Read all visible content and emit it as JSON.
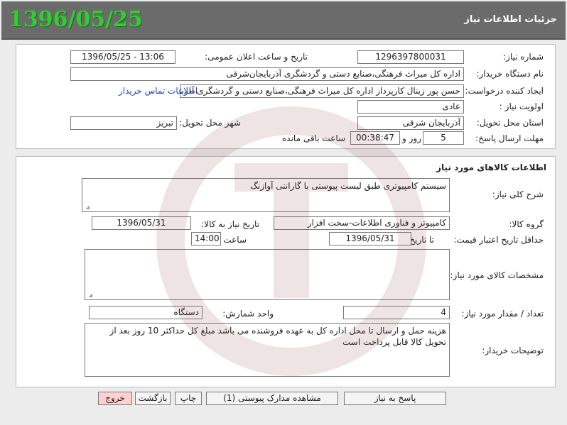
{
  "header": {
    "title": "جزئیات اطلاعات نیاز",
    "date": "1396/05/25"
  },
  "info": {
    "need_number_label": "شماره نیاز:",
    "need_number": "1296397800031",
    "announce_label": "تاریخ و ساعت اعلان عمومی:",
    "announce_value": "1396/05/25 - 13:06",
    "buyer_label": "نام دستگاه خریدار:",
    "buyer_value": "اداره کل میراث فرهنگی،صنایع دستی و گردشگری آذربایجان‌شرقی",
    "creator_label": "ایجاد کننده درخواست:",
    "creator_value": "حسن پور زینال کارپرداز اداره کل میراث فرهنگی،صنایع دستی و گردشگری آذربایجان‌شرقی",
    "contact_link": "اطلاعات تماس خریدار",
    "priority_label": "اولویت نیاز :",
    "priority_value": "عادی",
    "province_label": "استان محل تحویل:",
    "province_value": "آذربایجان شرقی",
    "city_label": "شهر محل تحویل:",
    "city_value": "تبریز",
    "deadline_label": "مهلت ارسال پاسخ:",
    "days_value": "5",
    "days_unit": "روز و",
    "time_value": "00:38:47",
    "time_unit": "ساعت باقی مانده"
  },
  "goods": {
    "section_title": "اطلاعات کالاهای مورد نیاز",
    "desc_label": "شرح کلی نیاز:",
    "desc_value": "سیستم کامپیوتری طبق لیست پیوستی با گارانتی آوازنگ",
    "group_label": "گروه کالا:",
    "group_value": "کامپیوتر و فناوری اطلاعات-سخت افزار",
    "need_date_label": "تاریخ نیاز به کالا:",
    "need_date_value": "1396/05/31",
    "validity_label": "حداقل تاریخ اعتبار قیمت:",
    "to_date_label": "تا تاریخ :",
    "to_date_value": "1396/05/31",
    "hour_label": "ساعت :",
    "hour_value": "14:00",
    "specs_label": "مشخصات کالای مورد نیاز:",
    "specs_value": "",
    "qty_label": "تعداد / مقدار مورد نیاز:",
    "qty_value": "4",
    "unit_label": "واحد شمارش:",
    "unit_value": "دستگاه",
    "notes_label": "توضیحات خریدار:",
    "notes_value": "هزینه حمل و ارسال تا محل اداره کل به عهده فروشنده می باشد مبلغ کل حداکثر 10 روز بعد از تحویل کالا قابل پرداخت است"
  },
  "buttons": {
    "reply": "پاسخ به نیاز",
    "attachments": "مشاهده مدارک پیوستی (1)",
    "print": "چاپ",
    "back": "بازگشت",
    "exit": "خروج"
  },
  "colors": {
    "header_bg": "#6b6b6b",
    "date_green": "#33cc33",
    "link_blue": "#1a3fbf",
    "exit_bg": "#ffd0d0"
  }
}
